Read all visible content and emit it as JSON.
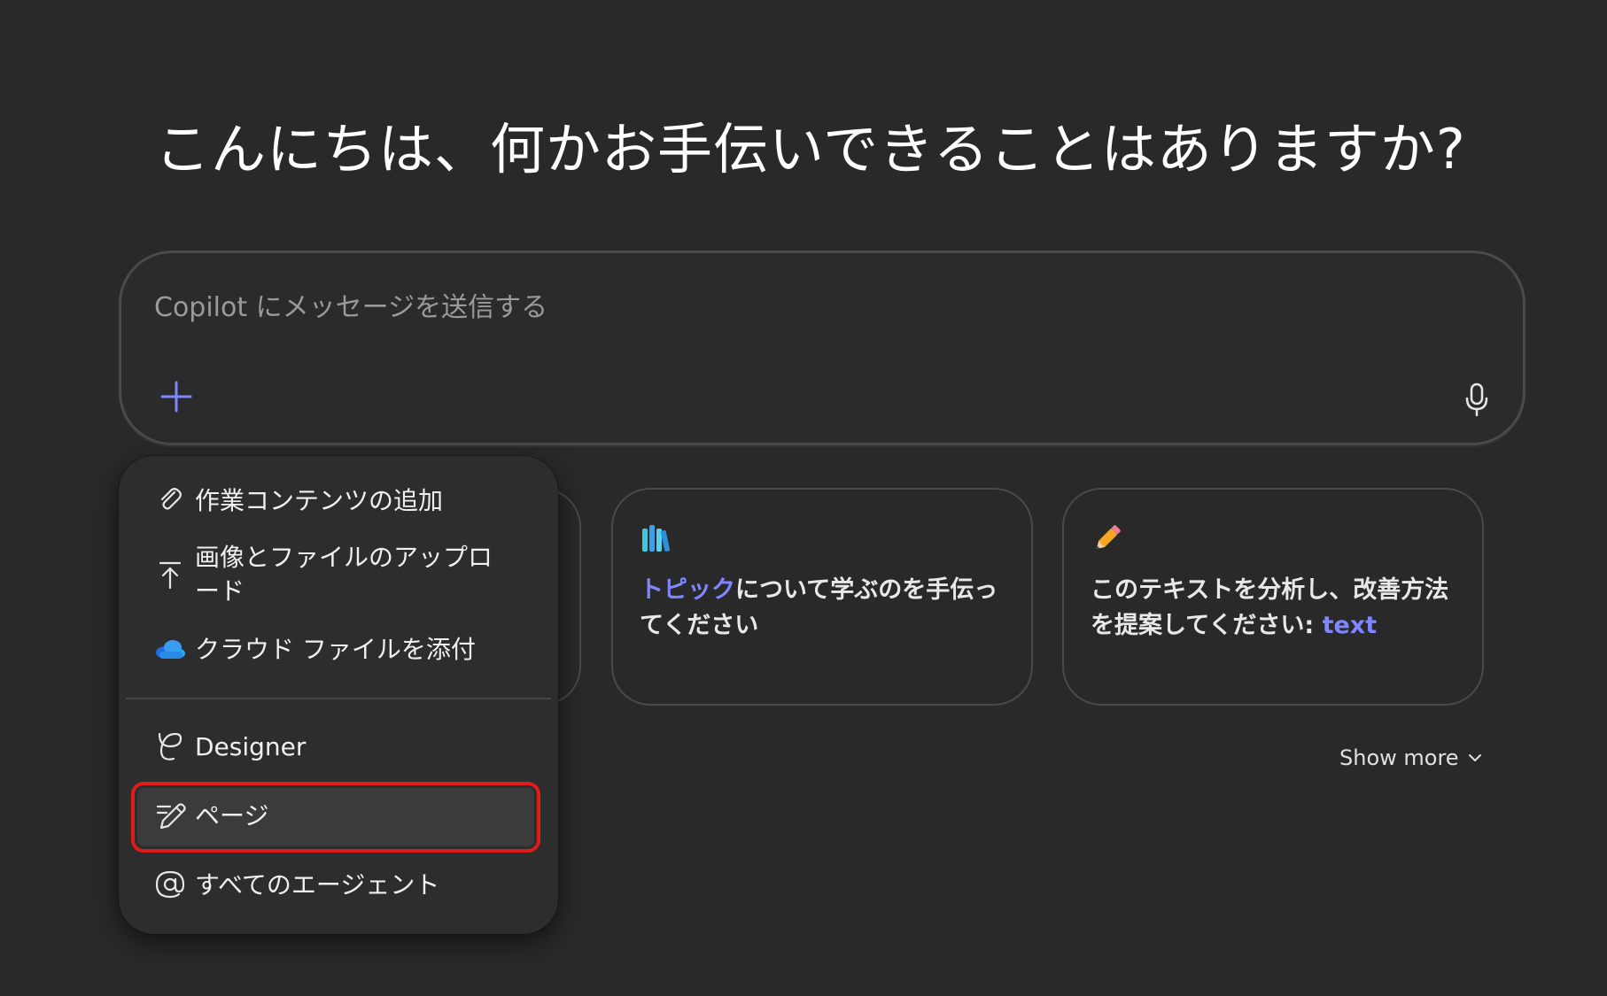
{
  "greeting": "こんにちは、何かお手伝いできることはありますか?",
  "composer": {
    "placeholder": "Copilot にメッセージを送信する",
    "add_icon": "plus-icon",
    "mic_icon": "microphone-icon"
  },
  "suggestions": [
    {
      "icon": "books-icon",
      "accent_text": "トピック",
      "text": "について学ぶのを手伝ってください"
    },
    {
      "icon": "pencil-icon",
      "text": "このテキストを分析し、改善方法を提案してください: ",
      "accent_text": "text"
    }
  ],
  "show_more": "Show more",
  "menu": {
    "items": [
      {
        "label": "作業コンテンツの追加",
        "icon": "paperclip-icon"
      },
      {
        "label": "画像とファイルのアップロード",
        "icon": "upload-icon"
      },
      {
        "label": "クラウド ファイルを添付",
        "icon": "onedrive-cloud-icon"
      },
      {
        "label": "Designer",
        "icon": "designer-icon"
      },
      {
        "label": "ページ",
        "icon": "pages-edit-icon",
        "highlighted": true
      },
      {
        "label": "すべてのエージェント",
        "icon": "at-sign-icon"
      }
    ]
  },
  "colors": {
    "background": "#292929",
    "accent": "#7f86ff",
    "highlight_border": "#e01b1b"
  }
}
